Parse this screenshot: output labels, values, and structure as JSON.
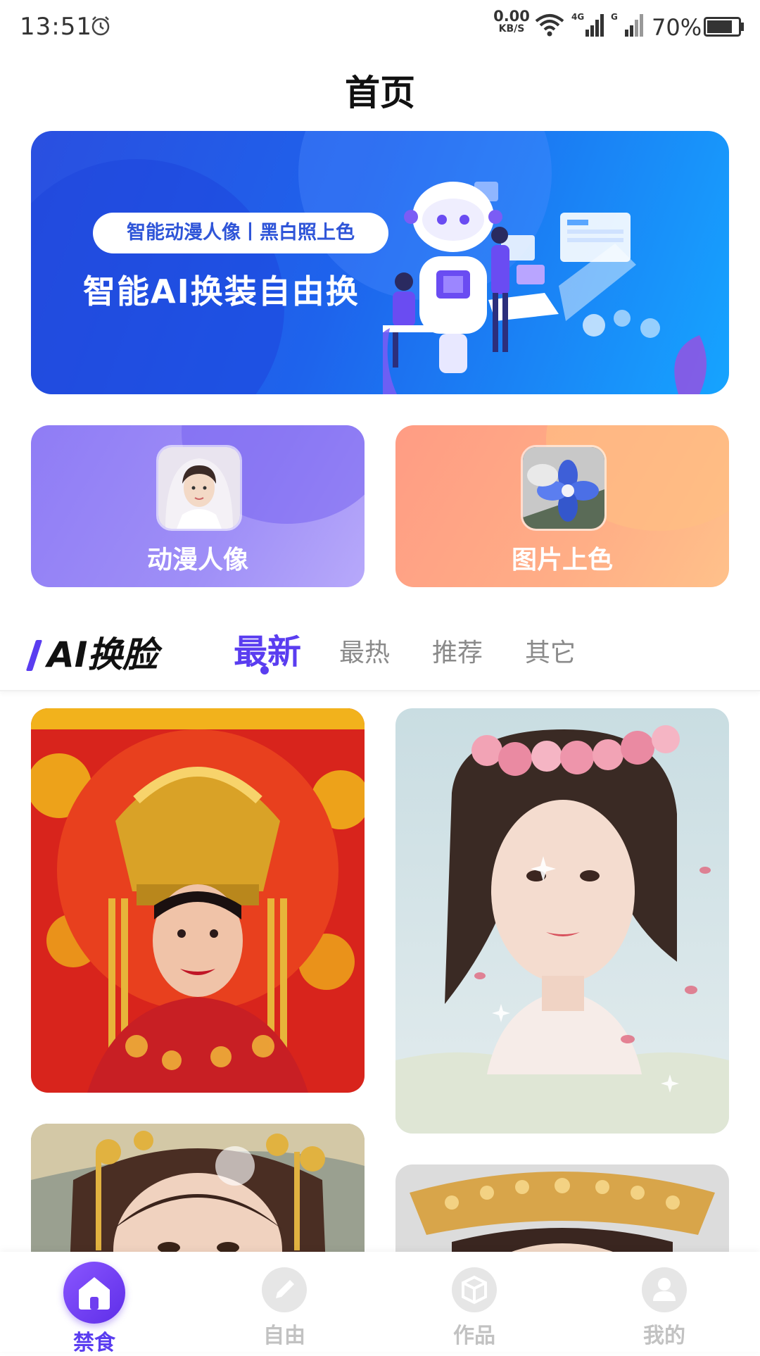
{
  "status_bar": {
    "time": "13:51",
    "net_speed_value": "0.00",
    "net_speed_unit": "KB/S",
    "network_type": "4G",
    "battery_text": "70%"
  },
  "header": {
    "title": "首页"
  },
  "banner": {
    "pill_text": "智能动漫人像丨黑白照上色",
    "headline": "智能AI换装自由换"
  },
  "features": [
    {
      "label": "动漫人像"
    },
    {
      "label": "图片上色"
    }
  ],
  "section": {
    "title": "AI换脸",
    "tabs": [
      {
        "label": "最新",
        "active": true
      },
      {
        "label": "最热",
        "active": false
      },
      {
        "label": "推荐",
        "active": false
      },
      {
        "label": "其它",
        "active": false
      }
    ]
  },
  "bottom_nav": [
    {
      "label": "禁食",
      "icon": "home-icon",
      "active": true
    },
    {
      "label": "自由",
      "icon": "pencil-icon",
      "active": false
    },
    {
      "label": "作品",
      "icon": "cube-icon",
      "active": false
    },
    {
      "label": "我的",
      "icon": "user-icon",
      "active": false
    }
  ],
  "colors": {
    "accent": "#5a3df0",
    "banner_blue": "#1e63ec",
    "anime_card": "#9f8ff7",
    "color_card": "#ffae86"
  }
}
